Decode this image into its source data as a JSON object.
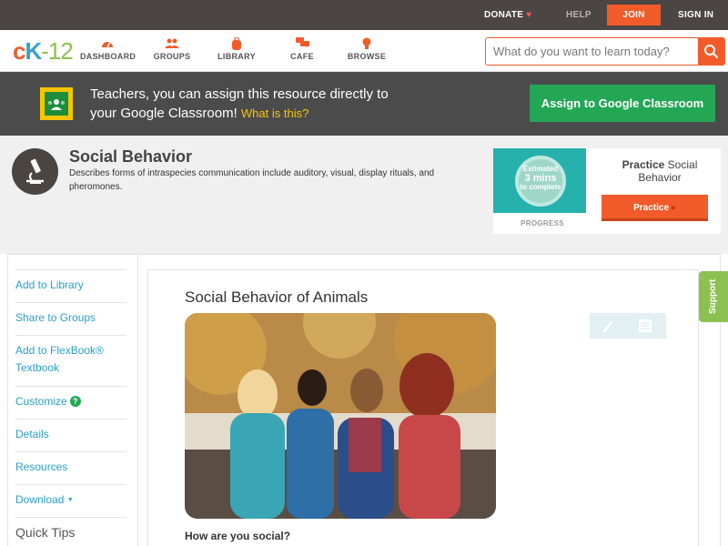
{
  "topbar": {
    "donate": "DONATE",
    "help": "HELP",
    "join": "JOIN",
    "signin": "SIGN IN"
  },
  "nav": {
    "logo_c": "c",
    "logo_k": "K",
    "logo_num": "-12",
    "items": [
      {
        "label": "DASHBOARD",
        "icon": "speedometer-icon"
      },
      {
        "label": "GROUPS",
        "icon": "people-icon"
      },
      {
        "label": "LIBRARY",
        "icon": "backpack-icon"
      },
      {
        "label": "CAFE",
        "icon": "chat-bubbles-icon"
      },
      {
        "label": "BROWSE",
        "icon": "lightbulb-icon"
      }
    ],
    "search_placeholder": "What do you want to learn today?"
  },
  "banner": {
    "message": "Teachers, you can assign this resource directly to your Google Classroom!",
    "what_link": "What is this?",
    "button": "Assign to Google Classroom"
  },
  "concept": {
    "title": "Social Behavior",
    "description": "Describes forms of intraspecies communication include auditory, visual, display rituals, and pheromones.",
    "progress": {
      "line1": "Estimated",
      "line2": "3 mins",
      "line3": "to complete",
      "label": "PROGRESS"
    },
    "practice_bold": "Practice",
    "practice_rest": "Social Behavior",
    "practice_button": "Practice"
  },
  "sidebar": {
    "items": [
      "Add to Library",
      "Share to Groups",
      "Add to FlexBook® Textbook",
      "Customize",
      "Details",
      "Resources",
      "Download",
      "Quick Tips"
    ],
    "customize_help": "?",
    "download_caret": "▼"
  },
  "content": {
    "heading": "Social Behavior of Animals",
    "question": "How are you social?"
  },
  "support": "Support",
  "colors": {
    "accent": "#f15b2a",
    "link": "#2a9fc9",
    "green": "#23a755",
    "dark": "#4b4643"
  }
}
